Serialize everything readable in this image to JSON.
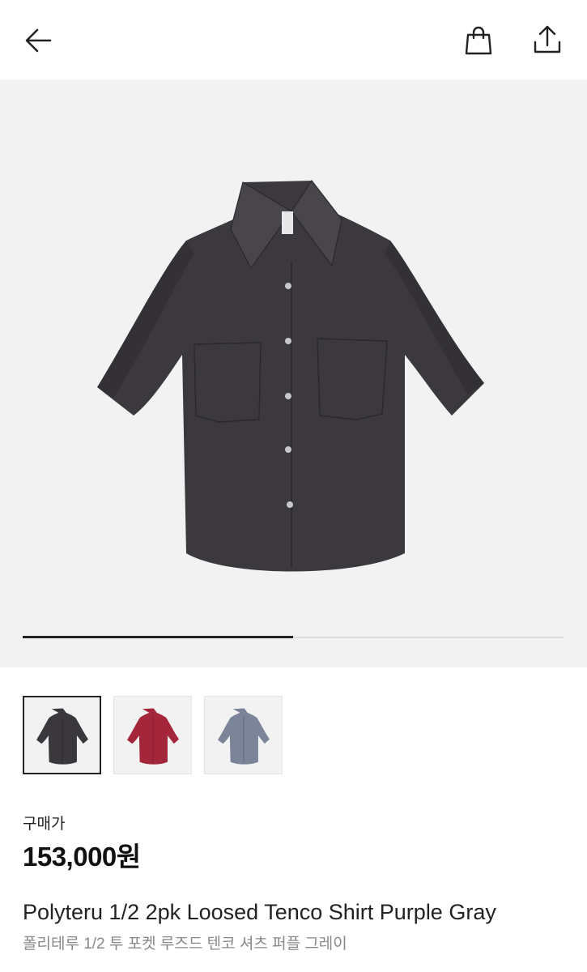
{
  "header": {
    "back_icon": "arrow-left-icon",
    "bag_icon": "shopping-bag-icon",
    "share_icon": "share-upload-icon"
  },
  "gallery": {
    "image": "short-sleeve-shirt-dark-purple-gray",
    "current_slide": 1,
    "total_slides": 2
  },
  "thumbnails": [
    {
      "color_name": "dark-gray",
      "color": "#3a383d",
      "selected": true
    },
    {
      "color_name": "burgundy",
      "color": "#a3263a",
      "selected": false
    },
    {
      "color_name": "blue-gray",
      "color": "#7b8498",
      "selected": false
    }
  ],
  "product": {
    "price_label": "구매가",
    "price": "153,000원",
    "name_en": "Polyteru 1/2 2pk Loosed Tenco Shirt Purple Gray",
    "name_ko": "폴리테루 1/2 투 포켓 루즈드 텐코 셔츠 퍼플 그레이"
  },
  "colors": {
    "background": "#ffffff",
    "gallery_bg": "#f2f2f2",
    "text_primary": "#222222",
    "text_secondary": "#888888"
  }
}
